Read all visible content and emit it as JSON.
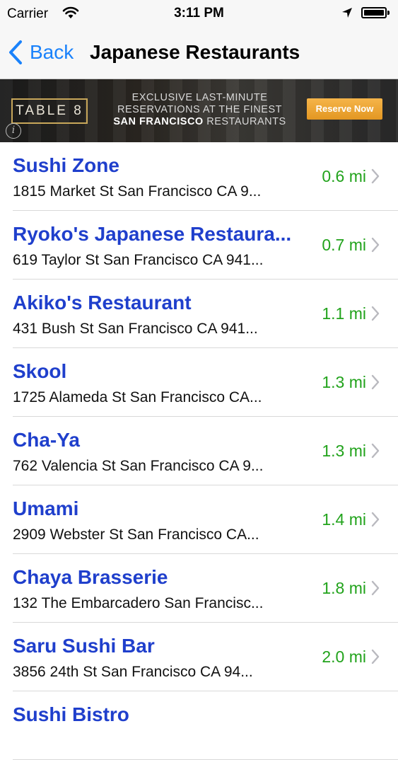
{
  "status_bar": {
    "carrier": "Carrier",
    "time": "3:11 PM",
    "icons": [
      "wifi-icon",
      "location-arrow-icon",
      "battery-icon"
    ]
  },
  "nav": {
    "back_label": "Back",
    "title": "Japanese Restaurants"
  },
  "ad": {
    "brand": "TABLE 8",
    "line1": "EXCLUSIVE LAST-MINUTE",
    "line2": "RESERVATIONS AT THE FINEST",
    "line3_bold": "SAN FRANCISCO",
    "line3_rest": " RESTAURANTS",
    "cta": "Reserve Now",
    "info_icon": "i"
  },
  "colors": {
    "link_blue": "#1a82fb",
    "name_blue": "#1f3fcc",
    "distance_green": "#22a31c"
  },
  "restaurants": [
    {
      "name": "Sushi Zone",
      "address": "1815 Market St San Francisco CA 9...",
      "distance": "0.6 mi"
    },
    {
      "name": "Ryoko's Japanese Restaura...",
      "address": "619 Taylor St San Francisco CA 941...",
      "distance": "0.7 mi"
    },
    {
      "name": "Akiko's Restaurant",
      "address": "431 Bush St San Francisco CA 941...",
      "distance": "1.1 mi"
    },
    {
      "name": "Skool",
      "address": "1725 Alameda St San Francisco CA...",
      "distance": "1.3 mi"
    },
    {
      "name": "Cha-Ya",
      "address": "762 Valencia St San Francisco CA 9...",
      "distance": "1.3 mi"
    },
    {
      "name": "Umami",
      "address": "2909 Webster St San Francisco CA...",
      "distance": "1.4 mi"
    },
    {
      "name": "Chaya Brasserie",
      "address": "132 The Embarcadero San Francisc...",
      "distance": "1.8 mi"
    },
    {
      "name": "Saru Sushi Bar",
      "address": "3856 24th St San Francisco CA 94...",
      "distance": "2.0 mi"
    },
    {
      "name": "Sushi Bistro",
      "address": "",
      "distance": ""
    }
  ]
}
